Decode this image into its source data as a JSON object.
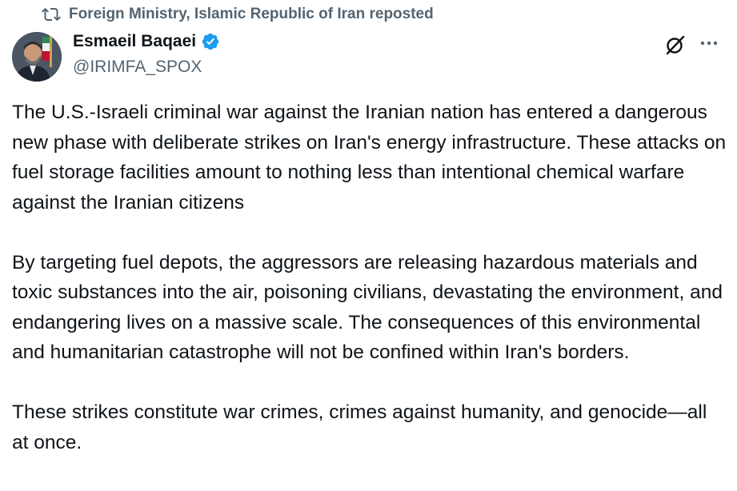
{
  "repost": {
    "icon": "repost-icon",
    "text": "Foreign Ministry, Islamic Republic of Iran reposted"
  },
  "author": {
    "avatar_icon": "avatar",
    "name": "Esmaeil Baqaei",
    "verified_icon": "verified-badge-icon",
    "handle": "@IRIMFA_SPOX"
  },
  "actions": {
    "grok_icon": "grok-icon",
    "more_icon": "more-options-icon"
  },
  "post": {
    "paragraphs": [
      "The U.S.-Israeli criminal war against the Iranian nation has entered a dangerous new phase with deliberate strikes on Iran's energy infrastructure. These attacks on fuel storage facilities amount to nothing less than intentional chemical warfare against the Iranian citizens",
      "By targeting fuel depots, the aggressors are releasing hazardous materials and toxic substances into the air, poisoning civilians, devastating the environment, and endangering lives on a massive scale. The consequences of this environmental and humanitarian catastrophe will not be confined within Iran's borders.",
      "These strikes constitute war crimes, crimes against humanity, and genocide—all at once."
    ]
  },
  "colors": {
    "text_primary": "#0f1419",
    "text_secondary": "#536471",
    "verified_blue": "#1d9bf0"
  }
}
